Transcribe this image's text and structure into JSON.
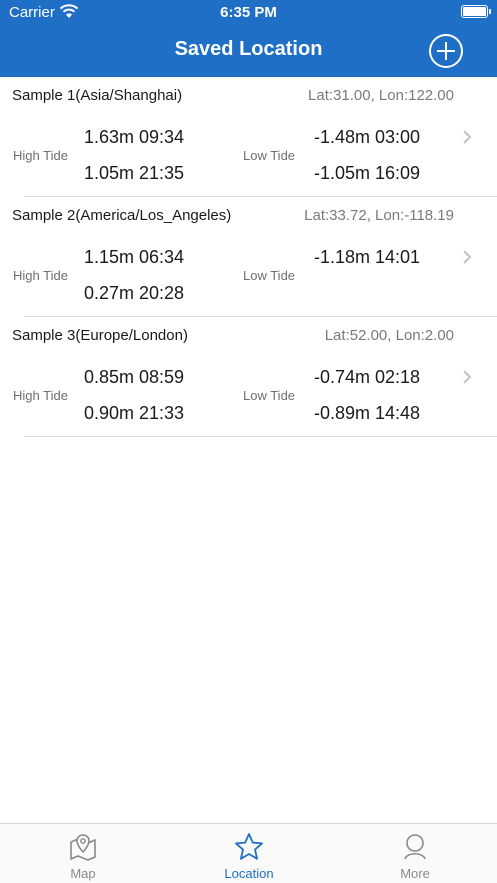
{
  "status": {
    "carrier": "Carrier",
    "time": "6:35 PM"
  },
  "nav": {
    "title": "Saved Location"
  },
  "colors": {
    "brand": "#1f6fc6",
    "text": "#1a1a1a",
    "muted": "#7a7a7a"
  },
  "locations": [
    {
      "name": "Sample 1(Asia/Shanghai)",
      "coords": "Lat:31.00, Lon:122.00",
      "high_label": "High Tide",
      "low_label": "Low Tide",
      "high": [
        "1.63m 09:34",
        "1.05m 21:35"
      ],
      "low": [
        "-1.48m 03:00",
        "-1.05m 16:09"
      ]
    },
    {
      "name": "Sample 2(America/Los_Angeles)",
      "coords": "Lat:33.72, Lon:-118.19",
      "high_label": "High Tide",
      "low_label": "Low Tide",
      "high": [
        "1.15m 06:34",
        "0.27m 20:28"
      ],
      "low": [
        "-1.18m 14:01",
        ""
      ]
    },
    {
      "name": "Sample 3(Europe/London)",
      "coords": "Lat:52.00, Lon:2.00",
      "high_label": "High Tide",
      "low_label": "Low Tide",
      "high": [
        "0.85m 08:59",
        "0.90m 21:33"
      ],
      "low": [
        "-0.74m 02:18",
        "-0.89m 14:48"
      ]
    }
  ],
  "tabs": [
    {
      "label": "Map",
      "icon": "map-pin-icon"
    },
    {
      "label": "Location",
      "icon": "star-icon"
    },
    {
      "label": "More",
      "icon": "more-icon"
    }
  ]
}
